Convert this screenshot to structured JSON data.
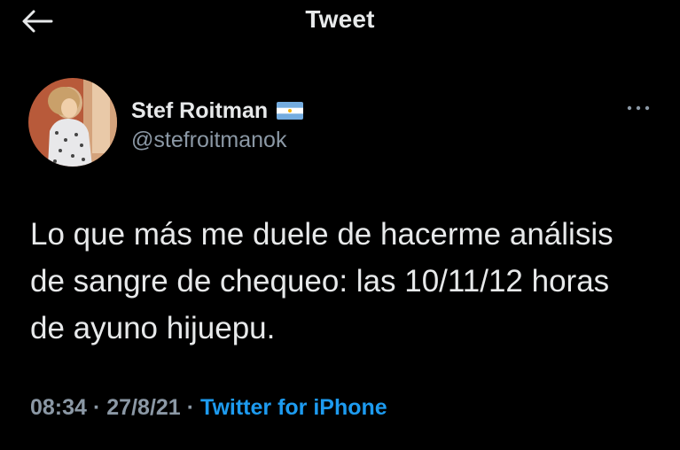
{
  "header": {
    "title": "Tweet",
    "back_icon": "arrow-left-icon"
  },
  "author": {
    "display_name": "Stef Roitman",
    "handle": "@stefroitmanok",
    "flag_icon": "argentina-flag-icon",
    "avatar_icon": "avatar"
  },
  "tweet": {
    "text": "Lo que más me duele de hacerme análisis de sangre de chequeo: las 10/11/12 horas de ayuno hijuepu.",
    "time": "08:34",
    "separator": "·",
    "date": "27/8/21",
    "source": "Twitter for iPhone"
  },
  "more_icon": "more-horizontal-icon",
  "colors": {
    "background": "#000000",
    "text": "#e7e9ea",
    "secondary": "#8b98a5",
    "link": "#1d9bf0"
  }
}
